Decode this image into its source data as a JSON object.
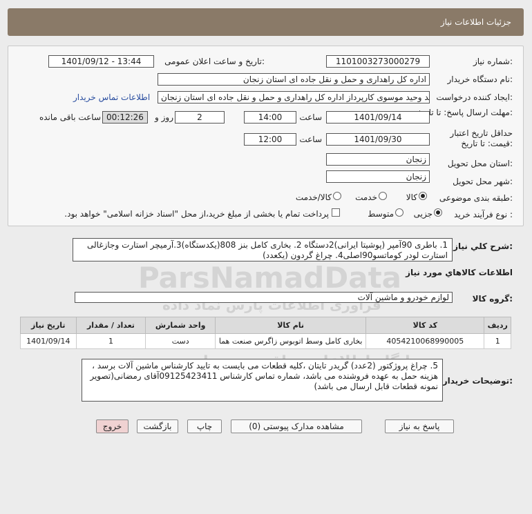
{
  "header": {
    "title": "جزئیات اطلاعات نیاز"
  },
  "form": {
    "need_number_label": "شماره نیاز:",
    "need_number": "1101003273000279",
    "announce_label": "تاریخ و ساعت اعلان عمومی:",
    "announce_value": "1401/09/12 - 13:44",
    "buyer_org_label": "نام دستگاه خریدار:",
    "buyer_org": "اداره کل راهداری و حمل و نقل جاده ای استان زنجان",
    "requester_label": "ایجاد کننده درخواست:",
    "requester": "سید وحید موسوی کارپرداز اداره کل راهداری و حمل و نقل جاده ای استان زنجان",
    "contact_link": "اطلاعات تماس خریدار",
    "deadline_label": "مهلت ارسال پاسخ: تا تاریخ:",
    "deadline_date": "1401/09/14",
    "time_label": "ساعت",
    "deadline_time": "14:00",
    "days_value": "2",
    "days_label": "روز و",
    "remaining_time": "00:12:26",
    "remaining_label": "ساعت باقی مانده",
    "validity_label_1": "حداقل تاریخ اعتبار",
    "validity_label_2": "قیمت: تا تاریخ:",
    "validity_date": "1401/09/30",
    "validity_time": "12:00",
    "province_label": "استان محل تحویل:",
    "province": "زنجان",
    "city_label": "شهر محل تحویل:",
    "city": "زنجان",
    "category_label": "طبقه بندی موضوعی:",
    "category_options": [
      "کالا",
      "خدمت",
      "کالا/خدمت"
    ],
    "category_selected": "کالا",
    "process_label": "نوع فرآیند خرید :",
    "process_options": [
      "جزیی",
      "متوسط"
    ],
    "process_selected": "جزیی",
    "treasury_note": "پرداخت تمام یا بخشی از مبلغ خرید،از محل \"اسناد خزانه اسلامی\" خواهد بود."
  },
  "summary": {
    "label": "شرح کلي نياز:",
    "text": "1. باطری 90آمپر (پوشیتا ایرانی)2دستگاه 2. بخاری کامل بنز 808(یکدستگاه)3.آرمیچر استارت وجازغالی استارت لودر کوماتسو90اصلی4. چراغ گردون (یکعدد)"
  },
  "goods": {
    "section_title": "اطلاعات کالاهاي مورد نياز",
    "group_label": "گروه کالا:",
    "group_value": "لوازم خودرو و ماشین آلات",
    "columns": [
      "ردیف",
      "کد کالا",
      "نام کالا",
      "واحد شمارش",
      "تعداد / مقدار",
      "تاریخ نیاز"
    ],
    "rows": [
      [
        "1",
        "4054210068990005",
        "بخاری کامل وسط اتوبوس زاگرس صنعت هما",
        "دست",
        "1",
        "1401/09/14"
      ]
    ]
  },
  "buyer_notes": {
    "label": "توضیحات خریدار:",
    "text": "5. چراغ پروژکتور (2عدد) گریدر تایتان ،کلیه قطعات می بایست به تایید کارشناس ماشین آلات برسد ، هزینه حمل به عهده فروشنده می باشد، شماره تماس کارشناس 09125423411آقای رمضانی(تصویر نمونه قطعات قابل ارسال می باشد)"
  },
  "buttons": {
    "reply": "پاسخ به نیاز",
    "attachments": "مشاهده مدارک پیوستی (0)",
    "print": "چاپ",
    "back": "بازگشت",
    "exit": "خروج"
  },
  "watermark": {
    "brand": "ParsNamadData",
    "tagline": "پایگاه اطلاعات مناقصه و مزایده",
    "tagline2": "فرآوری اطلاعات پارس نماد داده"
  }
}
